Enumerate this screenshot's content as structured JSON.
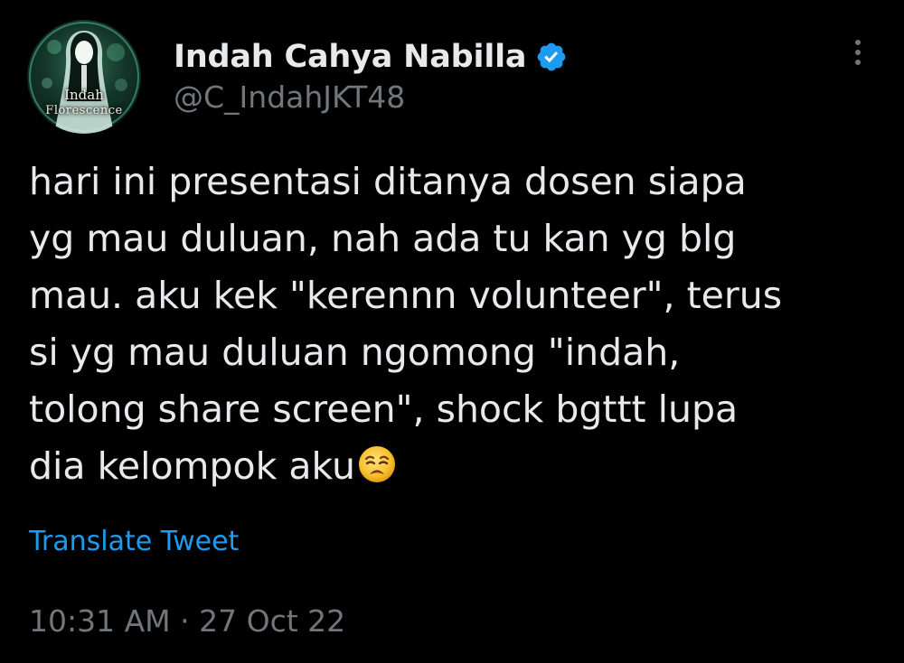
{
  "author": {
    "display_name": "Indah Cahya Nabilla",
    "handle": "@C_IndahJKT48",
    "verified": true,
    "avatar_text_line1": "Indah",
    "avatar_text_line2": "Florescence"
  },
  "tweet": {
    "lines": [
      "hari ini presentasi ditanya dosen siapa",
      "yg mau duluan, nah ada tu kan yg blg",
      "mau. aku kek \"kerennn volunteer\", terus",
      "si yg mau duluan ngomong \"indah,",
      "tolong share screen\", shock bgttt lupa",
      "dia kelompok aku"
    ],
    "emoji": "weary-face-icon",
    "translate_label": "Translate Tweet",
    "time": "10:31 AM",
    "separator": "·",
    "date": "27 Oct 22"
  },
  "icons": {
    "more": "more-vertical-icon",
    "verified": "verified-badge-icon"
  },
  "colors": {
    "background": "#000000",
    "text_primary": "#e7e9ea",
    "text_secondary": "#71767b",
    "link": "#1d9bf0",
    "verified": "#1d9bf0"
  }
}
